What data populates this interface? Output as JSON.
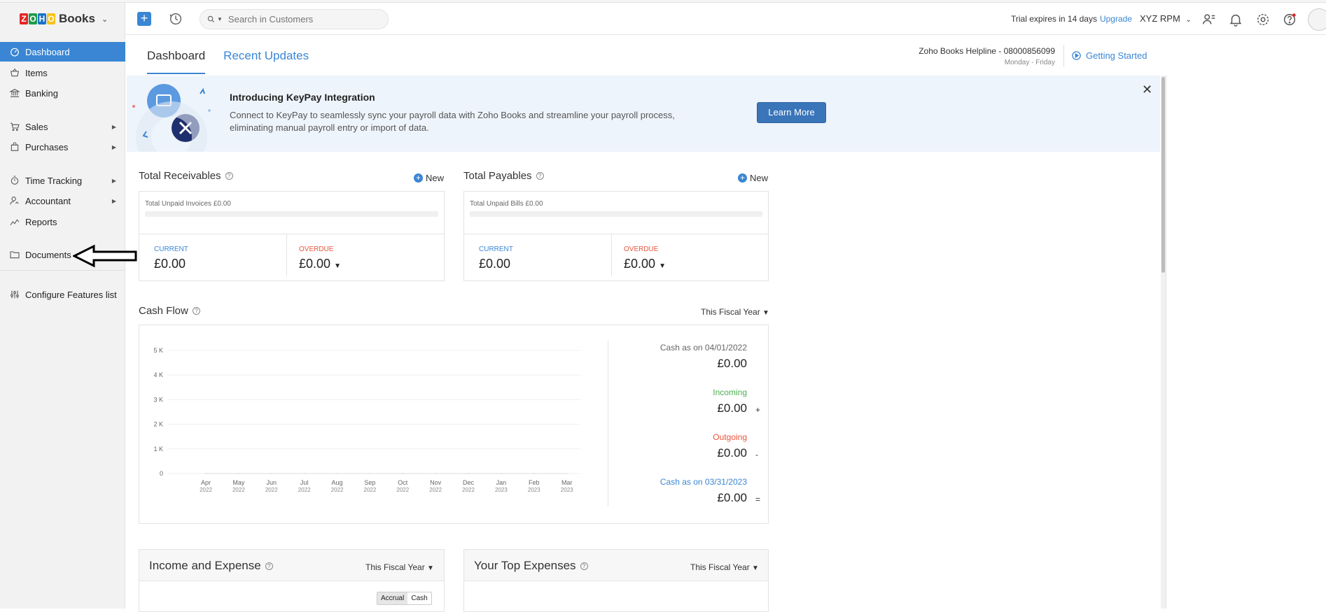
{
  "header": {
    "brand": "Books",
    "search_placeholder": "Search in Customers",
    "trial_text": "Trial expires in 14 days",
    "upgrade_label": "Upgrade",
    "org_name": "XYZ RPM"
  },
  "sidebar": {
    "items": [
      {
        "label": "Dashboard"
      },
      {
        "label": "Items"
      },
      {
        "label": "Banking"
      },
      {
        "label": "Sales"
      },
      {
        "label": "Purchases"
      },
      {
        "label": "Time Tracking"
      },
      {
        "label": "Accountant"
      },
      {
        "label": "Reports"
      },
      {
        "label": "Documents"
      },
      {
        "label": "Configure Features list"
      }
    ]
  },
  "tabs": [
    {
      "label": "Dashboard"
    },
    {
      "label": "Recent Updates"
    }
  ],
  "helpline": {
    "text": "Zoho Books Helpline - 08000856099",
    "hours": "Monday - Friday",
    "getting_started": "Getting Started"
  },
  "banner": {
    "title": "Introducing KeyPay Integration",
    "description": "Connect to KeyPay to seamlessly sync your payroll data with Zoho Books and streamline your payroll process, eliminating manual payroll entry or import of data.",
    "button": "Learn More"
  },
  "receivables": {
    "title": "Total Receivables",
    "new_label": "New",
    "unpaid": "Total Unpaid Invoices £0.00",
    "current_label": "CURRENT",
    "current_value": "£0.00",
    "overdue_label": "OVERDUE",
    "overdue_value": "£0.00"
  },
  "payables": {
    "title": "Total Payables",
    "new_label": "New",
    "unpaid": "Total Unpaid Bills £0.00",
    "current_label": "CURRENT",
    "current_value": "£0.00",
    "overdue_label": "OVERDUE",
    "overdue_value": "£0.00"
  },
  "cashflow": {
    "title": "Cash Flow",
    "period": "This Fiscal Year",
    "start_label": "Cash as on 04/01/2022",
    "start_value": "£0.00",
    "incoming_label": "Incoming",
    "incoming_value": "£0.00",
    "incoming_sign": "+",
    "outgoing_label": "Outgoing",
    "outgoing_value": "£0.00",
    "outgoing_sign": "-",
    "end_label": "Cash as on 03/31/2023",
    "end_value": "£0.00",
    "end_sign": "="
  },
  "chart_data": {
    "type": "line",
    "title": "",
    "categories": [
      "Apr 2022",
      "May 2022",
      "Jun 2022",
      "Jul 2022",
      "Aug 2022",
      "Sep 2022",
      "Oct 2022",
      "Nov 2022",
      "Dec 2022",
      "Jan 2023",
      "Feb 2023",
      "Mar 2023"
    ],
    "x_months": [
      "Apr",
      "May",
      "Jun",
      "Jul",
      "Aug",
      "Sep",
      "Oct",
      "Nov",
      "Dec",
      "Jan",
      "Feb",
      "Mar"
    ],
    "x_years": [
      "2022",
      "2022",
      "2022",
      "2022",
      "2022",
      "2022",
      "2022",
      "2022",
      "2022",
      "2023",
      "2023",
      "2023"
    ],
    "y_ticks": [
      "0",
      "1 K",
      "2 K",
      "3 K",
      "4 K",
      "5 K"
    ],
    "ylim": [
      0,
      5000
    ],
    "values": [
      0,
      0,
      0,
      0,
      0,
      0,
      0,
      0,
      0,
      0,
      0,
      0
    ],
    "grid": true
  },
  "income_expense": {
    "title": "Income and Expense",
    "period": "This Fiscal Year",
    "accrual": "Accrual",
    "cash": "Cash"
  },
  "top_expenses": {
    "title": "Your Top Expenses",
    "period": "This Fiscal Year"
  },
  "colors": {
    "accent": "#3a86d4",
    "overdue": "#e8553c",
    "incoming": "#4caf50",
    "outgoing": "#e8553c"
  }
}
